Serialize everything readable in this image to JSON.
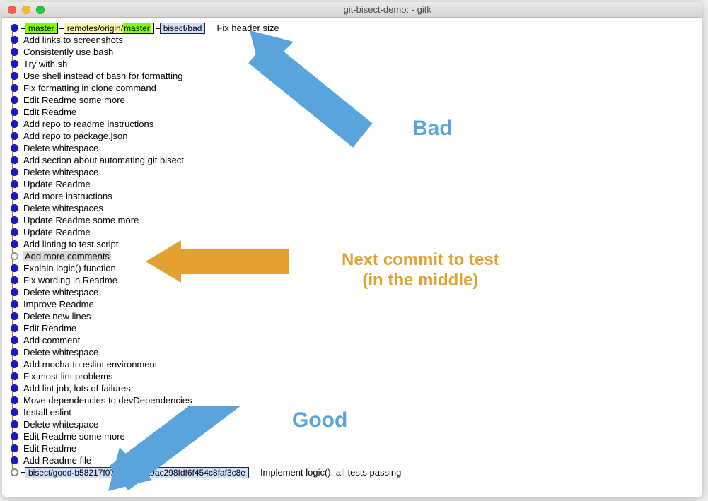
{
  "window": {
    "title": "git-bisect-demo:  - gitk"
  },
  "tags": {
    "master": "master",
    "remote_prefix": "remotes/origin/",
    "remote_branch": "master",
    "bisect_bad": "bisect/bad",
    "bisect_good": "bisect/good-b58217f071509f8da9ac298fdf6f454c8faf3c8e"
  },
  "commits": [
    {
      "msg": "Fix header size",
      "tags": [
        "master",
        "remote",
        "bisect_bad"
      ],
      "far_msg": true
    },
    {
      "msg": "Add links to screenshots"
    },
    {
      "msg": "Consistently use bash"
    },
    {
      "msg": "Try with sh"
    },
    {
      "msg": "Use shell instead of bash for formatting"
    },
    {
      "msg": "Fix formatting in clone command"
    },
    {
      "msg": "Edit Readme some more"
    },
    {
      "msg": "Edit Readme"
    },
    {
      "msg": "Add repo to readme instructions"
    },
    {
      "msg": "Add repo to package.json"
    },
    {
      "msg": "Delete whitespace"
    },
    {
      "msg": "Add section about automating git bisect"
    },
    {
      "msg": "Delete whitespace"
    },
    {
      "msg": "Update Readme"
    },
    {
      "msg": "Add more instructions"
    },
    {
      "msg": "Delete whitespaces"
    },
    {
      "msg": "Update Readme some more"
    },
    {
      "msg": "Update Readme"
    },
    {
      "msg": "Add linting to test script"
    },
    {
      "msg": "Add more comments",
      "head": true,
      "highlight": true
    },
    {
      "msg": "Explain logic() function"
    },
    {
      "msg": "Fix wording in Readme"
    },
    {
      "msg": "Delete whitespace"
    },
    {
      "msg": "Improve Readme"
    },
    {
      "msg": "Delete new lines"
    },
    {
      "msg": "Edit Readme"
    },
    {
      "msg": "Add comment"
    },
    {
      "msg": "Delete whitespace"
    },
    {
      "msg": "Add mocha to eslint environment"
    },
    {
      "msg": "Fix most lint problems"
    },
    {
      "msg": "Add lint job, lots of failures"
    },
    {
      "msg": "Move dependencies to devDependencies"
    },
    {
      "msg": "Install eslint"
    },
    {
      "msg": "Delete whitespace"
    },
    {
      "msg": "Edit Readme some more"
    },
    {
      "msg": "Edit Readme"
    },
    {
      "msg": "Add Readme file"
    },
    {
      "msg": "Implement logic(), all tests passing",
      "tags": [
        "bisect_good"
      ],
      "last": true,
      "far_msg": true
    }
  ],
  "annotations": {
    "bad": "Bad",
    "next1": "Next commit to test",
    "next2": "(in the middle)",
    "good": "Good"
  }
}
